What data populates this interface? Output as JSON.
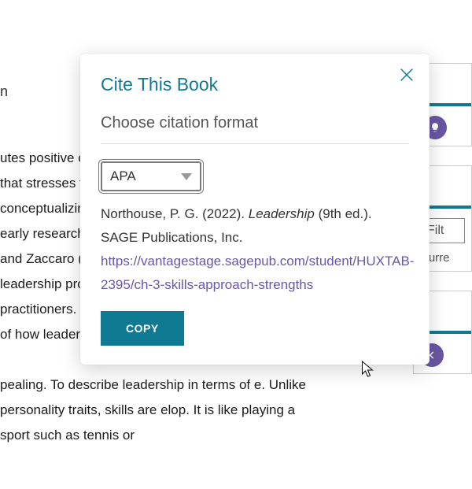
{
  "background_heading_fragment": "n",
  "background_text": "utes positive contributions. By including leadership del that stresses the importance of the leader's roach to conceptualizing and creating change. Whereas the early research on skills highlighted the value of skilky and Zaccaro (2007), Mumford put at the center of the leadership process. It is a skills approach for practitioners. Despite the here is a poor understanding of how leaders' f, Baur, & Buckley, 2016).\n\npealing. To describe leadership in terms of e. Unlike personality traits, skills are elop. It is like playing a sport such as tennis or",
  "modal": {
    "title": "Cite This Book",
    "subtitle": "Choose citation format",
    "format": "APA",
    "citation_prefix": "Northouse, P. G. (2022). ",
    "citation_title_ital": "Leadership",
    "citation_suffix": " (9th ed.). SAGE Publications, Inc. ",
    "citation_url": "https://vantagestage.sagepub.com/student/HUXTAB-2395/ch-3-skills-approach-strengths",
    "copy_label": "COPY"
  },
  "right": {
    "filter_placeholder": "Filt",
    "current_label": "Curre"
  }
}
